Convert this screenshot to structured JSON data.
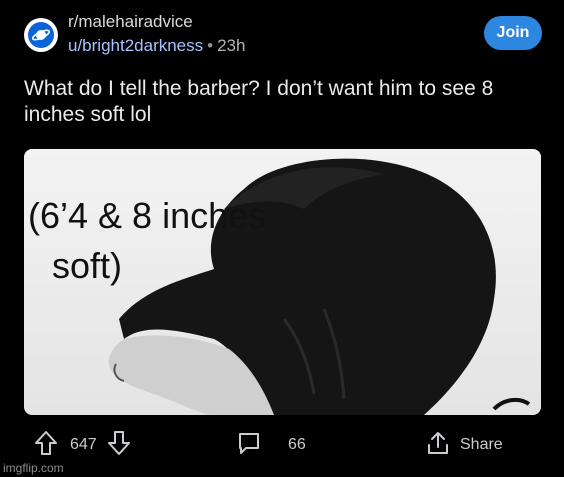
{
  "post": {
    "subreddit": "r/malehairadvice",
    "author": "u/bright2darkness",
    "separator": "•",
    "time": "23h",
    "join_label": "Join",
    "title": "What do I tell the barber? I don’t want him to see 8 inches soft lol",
    "image_caption_line1": "(6’4 & 8 inches",
    "image_caption_line2": "soft)"
  },
  "actions": {
    "upvotes": "647",
    "comments": "66",
    "share_label": "Share"
  },
  "watermark": "imgflip.com",
  "colors": {
    "background": "#000000",
    "join_button": "#2d86e0",
    "author_link": "#a7c3ff",
    "avatar": "#0a63d8"
  },
  "icons": [
    "planet-icon",
    "upvote-icon",
    "downvote-icon",
    "comment-icon",
    "share-icon"
  ]
}
